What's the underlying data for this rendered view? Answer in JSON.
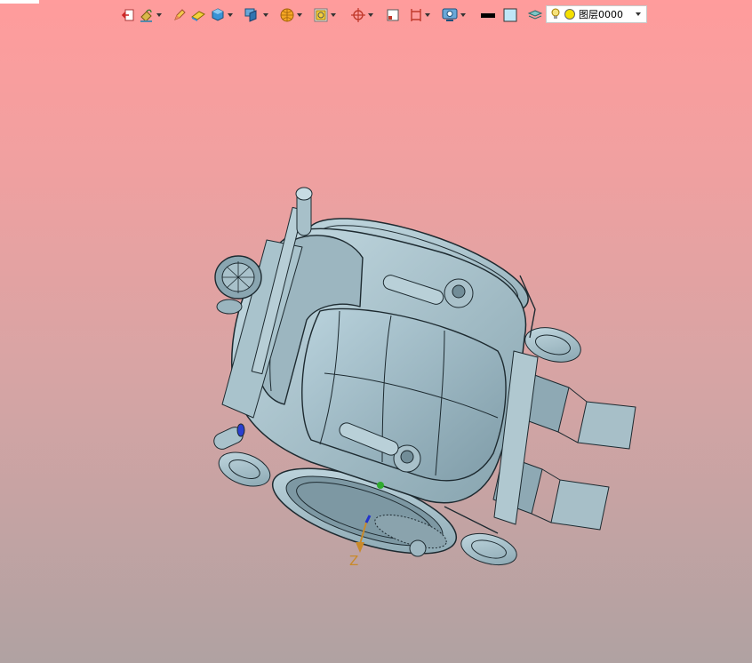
{
  "toolbar": {
    "layer": {
      "name": "图层0000"
    }
  },
  "axis": {
    "z_label": "Z"
  },
  "colors": {
    "background_top": "#ff9c9c",
    "background_bottom": "#b0a2a2",
    "model_fill": "#9fb8c2",
    "model_edge": "#1d2a30",
    "axis_color": "#c98a2a"
  }
}
